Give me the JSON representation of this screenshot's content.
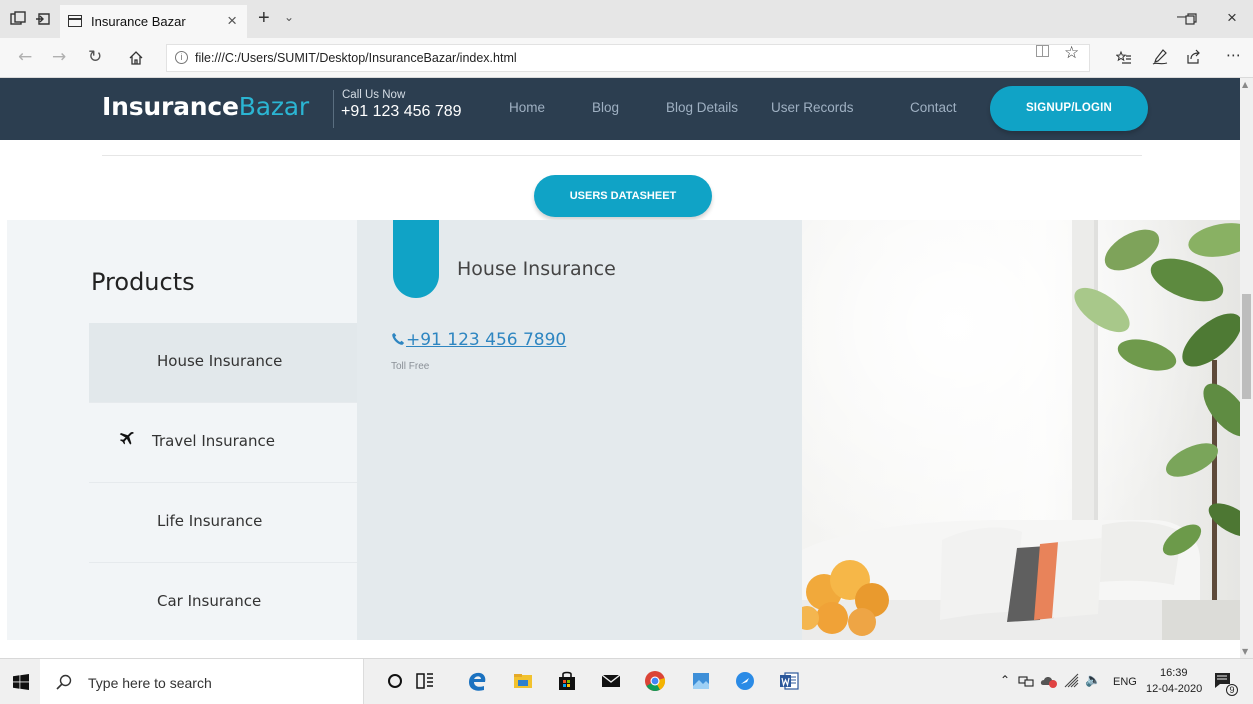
{
  "browser": {
    "tab_title": "Insurance Bazar",
    "tab_close": "×",
    "new_tab": "+",
    "url": "file:///C:/Users/SUMIT/Desktop/InsuranceBazar/index.html",
    "icons": [
      "tab-preview-icon",
      "set-aside-tabs-icon",
      "back-icon",
      "forward-icon",
      "refresh-icon",
      "home-icon",
      "info-icon",
      "reading-view-icon",
      "favorite-star-icon",
      "favorites-list-icon",
      "pen-icon",
      "share-icon",
      "more-icon"
    ]
  },
  "header": {
    "logo_bold": "Insurance",
    "logo_light": "Bazar",
    "call_label": "Call Us Now",
    "call_number": "+91 123 456 789",
    "menu": [
      "Home",
      "Blog",
      "Blog Details",
      "User Records",
      "Contact"
    ],
    "signup": "SIGNUP/LOGIN"
  },
  "main": {
    "datasheet_button": "USERS DATASHEET",
    "products_title": "Products",
    "products": [
      "House Insurance",
      "Travel Insurance",
      "Life Insurance",
      "Car Insurance"
    ],
    "active_product": "House Insurance",
    "detail_title": "House Insurance",
    "phone": "+91 123 456 7890",
    "toll_free": "Toll Free"
  },
  "taskbar": {
    "search_placeholder": "Type here to search",
    "language": "ENG",
    "time": "16:39",
    "date": "12-04-2020",
    "notification_count": "9"
  },
  "colors": {
    "header_bg": "#2c3e50",
    "accent": "#10a3c6",
    "logo_light": "#2bb5d3",
    "link": "#2e86c1"
  }
}
